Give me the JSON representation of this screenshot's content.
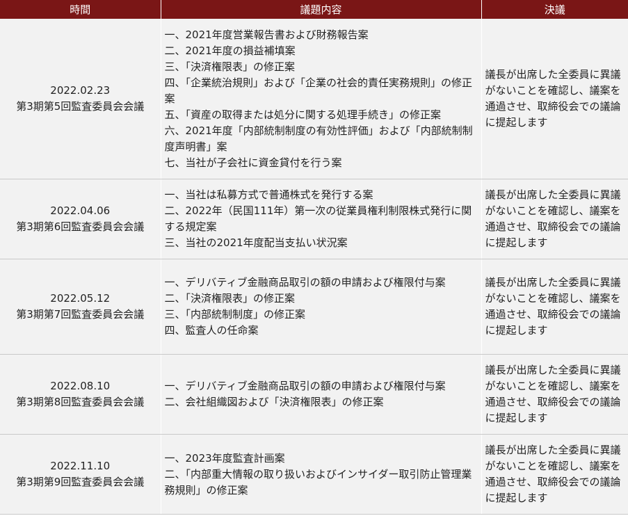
{
  "headers": {
    "time": "時間",
    "agenda": "議題内容",
    "resolution": "決議"
  },
  "rows": [
    {
      "date": "2022.02.23",
      "meeting": "第3期第5回監査委員会会議",
      "agenda": [
        "一、2021年度営業報告書および財務報告案",
        "二、2021年度の損益補填案",
        "三、「決済権限表」の修正案",
        "四、「企業統治規則」および「企業の社会的責任実務規則」の修正案",
        "五、「資産の取得または処分に関する処理手続き」の修正案",
        "六、2021年度「内部統制制度の有効性評価」および「内部統制制度声明書」案",
        "七、当社が子会社に資金貸付を行う案"
      ],
      "resolution": "議長が出席した全委員に異議がないことを確認し、議案を通過させ、取締役会での議論に提起します"
    },
    {
      "date": "2022.04.06",
      "meeting": "第3期第6回監査委員会会議",
      "agenda": [
        "一、当社は私募方式で普通株式を発行する案",
        "二、2022年（民国111年）第一次の従業員権利制限株式発行に関する規定案",
        "三、当社の2021年度配当支払い状況案"
      ],
      "resolution": "議長が出席した全委員に異議がないことを確認し、議案を通過させ、取締役会での議論に提起します"
    },
    {
      "date": "2022.05.12",
      "meeting": "第3期第7回監査委員会会議",
      "agenda": [
        "一、デリバティブ金融商品取引の額の申請および権限付与案",
        "二、「決済権限表」の修正案",
        "三、「内部統制制度」の修正案",
        "四、監査人の任命案"
      ],
      "resolution": "議長が出席した全委員に異議がないことを確認し、議案を通過させ、取締役会での議論に提起します"
    },
    {
      "date": "2022.08.10",
      "meeting": "第3期第8回監査委員会会議",
      "agenda": [
        "一、デリバティブ金融商品取引の額の申請および権限付与案",
        "二、会社組織図および「決済権限表」の修正案"
      ],
      "resolution": "議長が出席した全委員に異議がないことを確認し、議案を通過させ、取締役会での議論に提起します"
    },
    {
      "date": "2022.11.10",
      "meeting": "第3期第9回監査委員会会議",
      "agenda": [
        "一、2023年度監査計画案",
        "二、「内部重大情報の取り扱いおよびインサイダー取引防止管理業務規則」の修正案"
      ],
      "resolution": "議長が出席した全委員に異議がないことを確認し、議案を通過させ、取締役会での議論に提起します"
    }
  ]
}
